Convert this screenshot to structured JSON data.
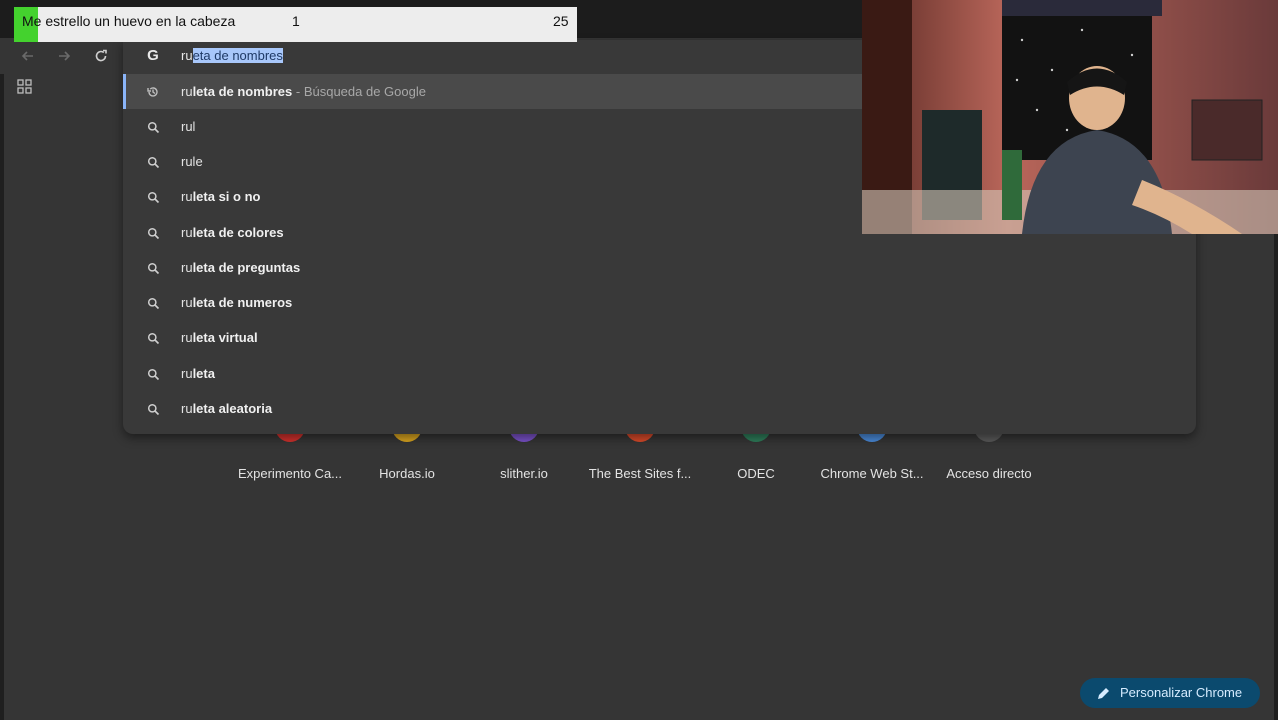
{
  "overlay": {
    "title": "Me estrello un huevo en la cabeza",
    "count": "1",
    "goal": "25",
    "accent": "#44d22e"
  },
  "omnibox": {
    "typed": "ru",
    "autocomplete": "eta de nombres",
    "engine_icon": "G"
  },
  "suggestions": [
    {
      "prefix": "ru",
      "bold": "leta de nombres",
      "sub": " - Búsqueda de Google",
      "icon": "history-icon",
      "selected": true
    },
    {
      "prefix": "rul",
      "bold": "",
      "sub": "",
      "icon": "search-icon"
    },
    {
      "prefix": "rule",
      "bold": "",
      "sub": "",
      "icon": "search-icon"
    },
    {
      "prefix": "ru",
      "bold": "leta si o no",
      "sub": "",
      "icon": "search-icon"
    },
    {
      "prefix": "ru",
      "bold": "leta de colores",
      "sub": "",
      "icon": "search-icon"
    },
    {
      "prefix": "ru",
      "bold": "leta de preguntas",
      "sub": "",
      "icon": "search-icon"
    },
    {
      "prefix": "ru",
      "bold": "leta de numeros",
      "sub": "",
      "icon": "search-icon"
    },
    {
      "prefix": "ru",
      "bold": "leta virtual",
      "sub": "",
      "icon": "search-icon"
    },
    {
      "prefix": "ru",
      "bold": "leta",
      "sub": "",
      "icon": "search-icon"
    },
    {
      "prefix": "ru",
      "bold": "leta aleatoria",
      "sub": "",
      "icon": "search-icon"
    }
  ],
  "shortcuts": [
    {
      "label": "Experimento Ca...",
      "color": "#d0312d"
    },
    {
      "label": "Hordas.io",
      "color": "#d9a520"
    },
    {
      "label": "slither.io",
      "color": "#7a52c9"
    },
    {
      "label": "The Best Sites f...",
      "color": "#d84a2a"
    },
    {
      "label": "ODEC",
      "color": "#2e7d5a"
    },
    {
      "label": "Chrome Web St...",
      "color": "#4a8ad9"
    },
    {
      "label": "Acceso directo",
      "color": "#5a5a5a"
    }
  ],
  "customize": {
    "label": "Personalizar Chrome"
  }
}
